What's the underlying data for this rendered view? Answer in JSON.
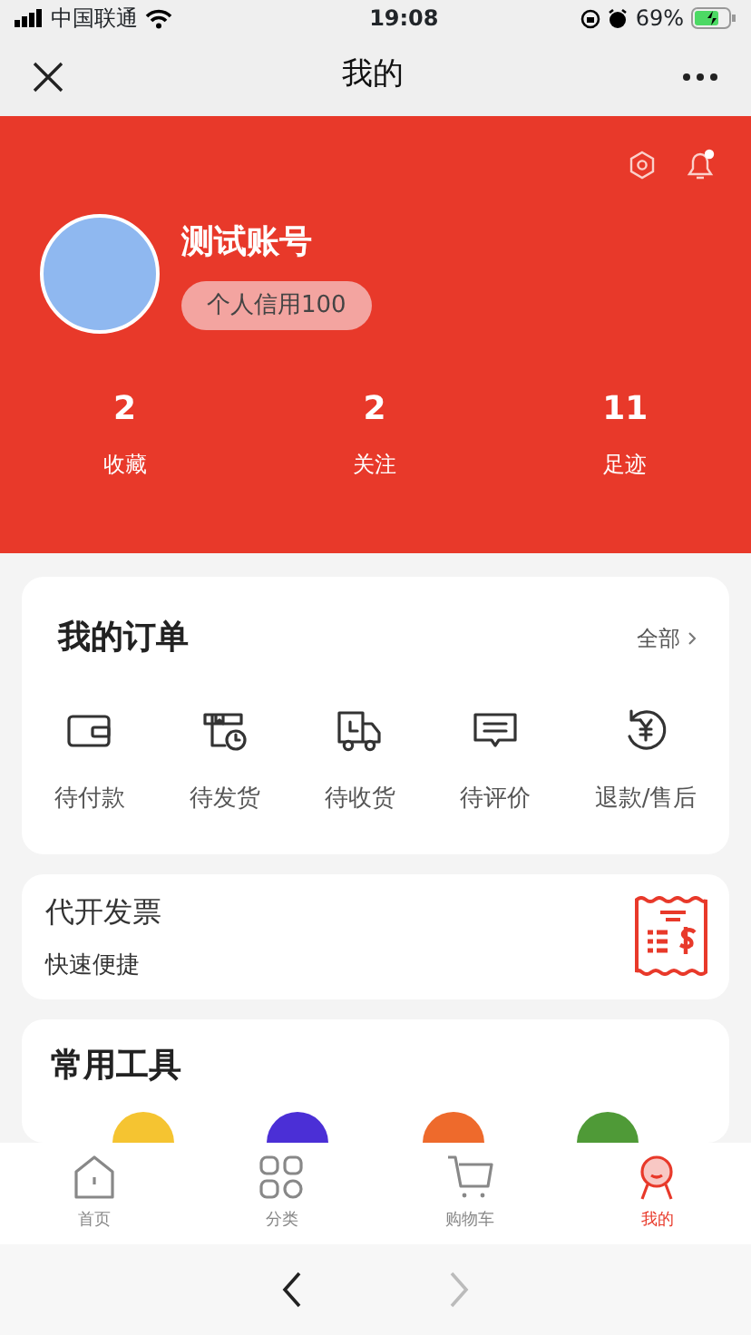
{
  "status_bar": {
    "carrier": "中国联通",
    "time": "19:08",
    "battery": "69%"
  },
  "nav": {
    "title": "我的"
  },
  "profile": {
    "name": "测试账号",
    "credit": "个人信用100",
    "has_notification": true,
    "stats": [
      {
        "value": "2",
        "label": "收藏"
      },
      {
        "value": "2",
        "label": "关注"
      },
      {
        "value": "11",
        "label": "足迹"
      }
    ]
  },
  "orders": {
    "title": "我的订单",
    "more": "全部",
    "items": [
      {
        "kind": "wallet",
        "label": "待付款"
      },
      {
        "kind": "box",
        "label": "待发货"
      },
      {
        "kind": "truck",
        "label": "待收货"
      },
      {
        "kind": "comment",
        "label": "待评价"
      },
      {
        "kind": "refund",
        "label": "退款/售后"
      }
    ]
  },
  "invoice": {
    "title": "代开发票",
    "subtitle": "快速便捷"
  },
  "tools": {
    "title": "常用工具",
    "items": [
      {
        "color": "#f5c431"
      },
      {
        "color": "#4b2fd6"
      },
      {
        "color": "#ee6a2c"
      },
      {
        "color": "#4f9a37"
      }
    ]
  },
  "tabbar": [
    {
      "kind": "home",
      "label": "首页",
      "selected": false
    },
    {
      "kind": "grid",
      "label": "分类",
      "selected": false
    },
    {
      "kind": "cart",
      "label": "购物车",
      "selected": false
    },
    {
      "kind": "user",
      "label": "我的",
      "selected": true
    }
  ],
  "browser": {
    "back_disabled": false,
    "forward_disabled": true
  }
}
